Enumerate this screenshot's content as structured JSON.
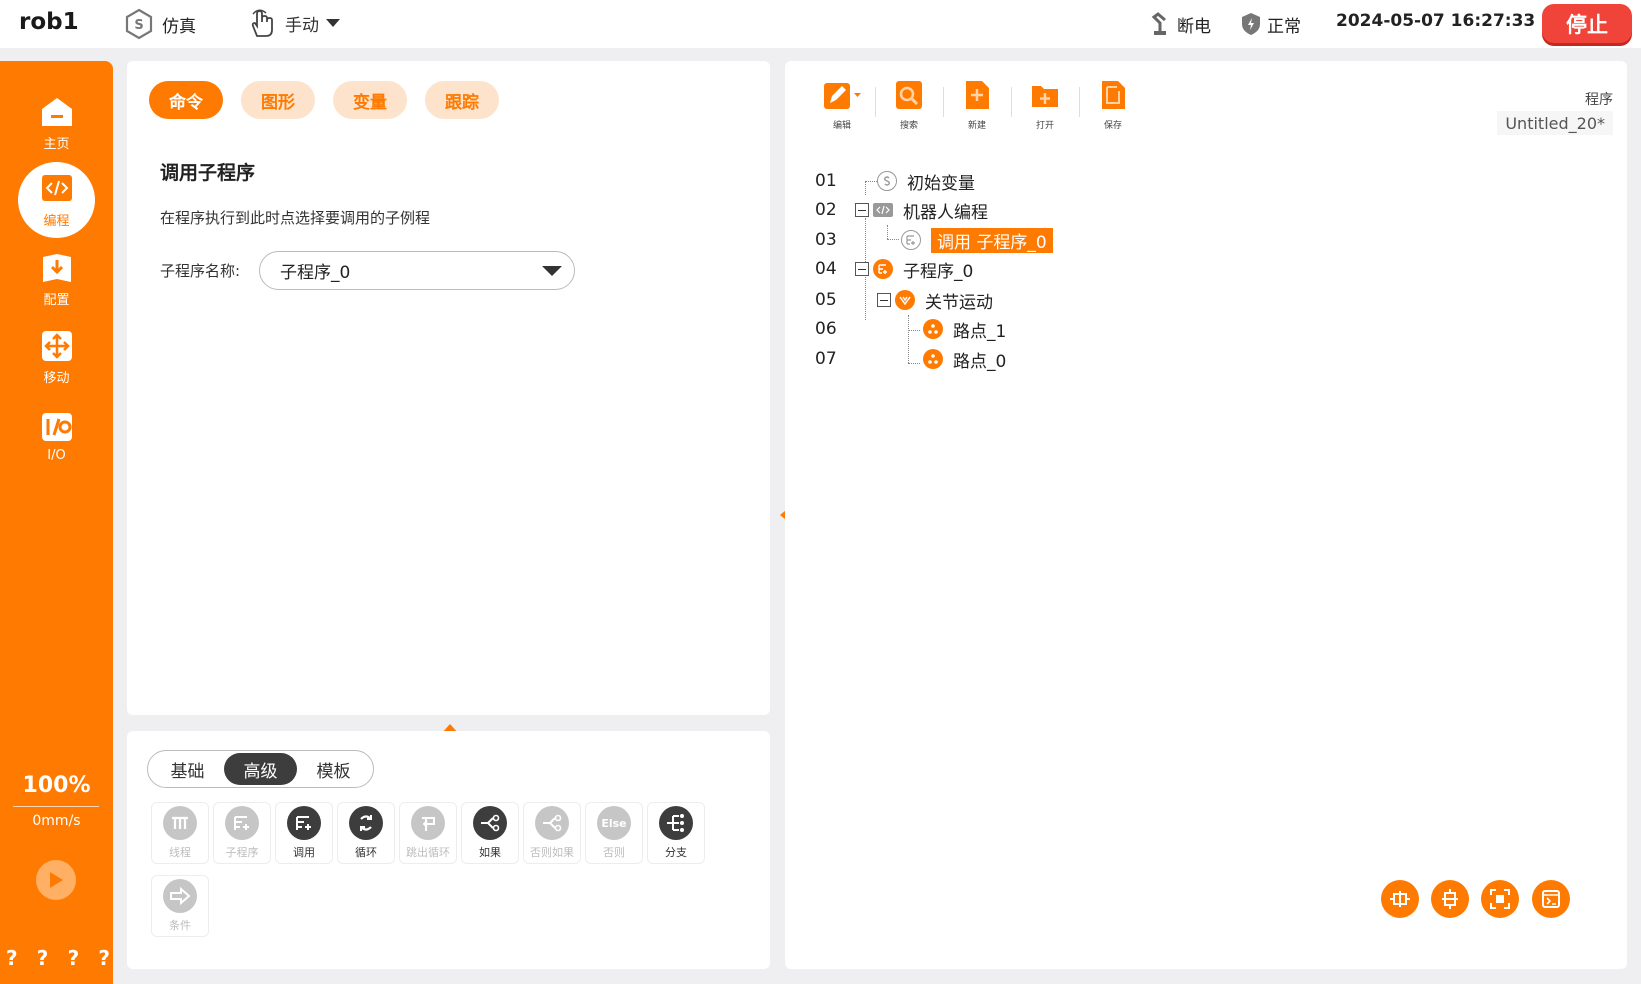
{
  "header": {
    "robot_name": "rob1",
    "sim_label": "仿真",
    "manual_label": "手动",
    "power_label": "断电",
    "safety_label": "正常",
    "datetime": "2024-05-07 16:27:33",
    "stop_label": "停止"
  },
  "sidebar": {
    "items": [
      {
        "label": "主页",
        "icon": "home-icon"
      },
      {
        "label": "编程",
        "icon": "code-icon"
      },
      {
        "label": "配置",
        "icon": "install-icon"
      },
      {
        "label": "移动",
        "icon": "move-icon"
      },
      {
        "label": "I/O",
        "icon": "io-icon"
      }
    ],
    "speed_percent": "100%",
    "speed_value": "0mm/s",
    "help": [
      "?",
      "?",
      "?",
      "?"
    ]
  },
  "command_panel": {
    "tabs": [
      "命令",
      "图形",
      "变量",
      "跟踪"
    ],
    "active_tab": 0,
    "title": "调用子程序",
    "description": "在程序执行到此时点选择要调用的子例程",
    "field_label": "子程序名称:",
    "field_value": "子程序_0"
  },
  "tools_panel": {
    "segments": [
      "基础",
      "高级",
      "模板"
    ],
    "active_segment": 1,
    "tools": [
      {
        "label": "线程",
        "enabled": false,
        "icon": "thread-icon"
      },
      {
        "label": "子程序",
        "enabled": false,
        "icon": "subprogram-icon"
      },
      {
        "label": "调用",
        "enabled": true,
        "icon": "call-icon"
      },
      {
        "label": "循环",
        "enabled": true,
        "icon": "loop-icon"
      },
      {
        "label": "跳出循环",
        "enabled": false,
        "icon": "break-icon"
      },
      {
        "label": "如果",
        "enabled": true,
        "icon": "if-icon"
      },
      {
        "label": "否则如果",
        "enabled": false,
        "icon": "elseif-icon"
      },
      {
        "label": "否则",
        "enabled": false,
        "icon": "else-icon"
      },
      {
        "label": "分支",
        "enabled": true,
        "icon": "switch-icon"
      },
      {
        "label": "条件",
        "enabled": false,
        "icon": "condition-icon"
      }
    ],
    "else_glyph": "Else"
  },
  "program_panel": {
    "toolbar": [
      "编辑",
      "搜索",
      "新建",
      "打开",
      "保存"
    ],
    "program_label": "程序",
    "program_name": "Untitled_20*",
    "lines": [
      {
        "num": "01",
        "text": "初始变量"
      },
      {
        "num": "02",
        "text": "机器人编程"
      },
      {
        "num": "03",
        "text": "调用 子程序_0",
        "selected": true
      },
      {
        "num": "04",
        "text": "子程序_0"
      },
      {
        "num": "05",
        "text": "关节运动"
      },
      {
        "num": "06",
        "text": "路点_1"
      },
      {
        "num": "07",
        "text": "路点_0"
      }
    ]
  },
  "colors": {
    "accent": "#ff7a00",
    "stop": "#f0443a",
    "dark": "#3d3d3d"
  }
}
